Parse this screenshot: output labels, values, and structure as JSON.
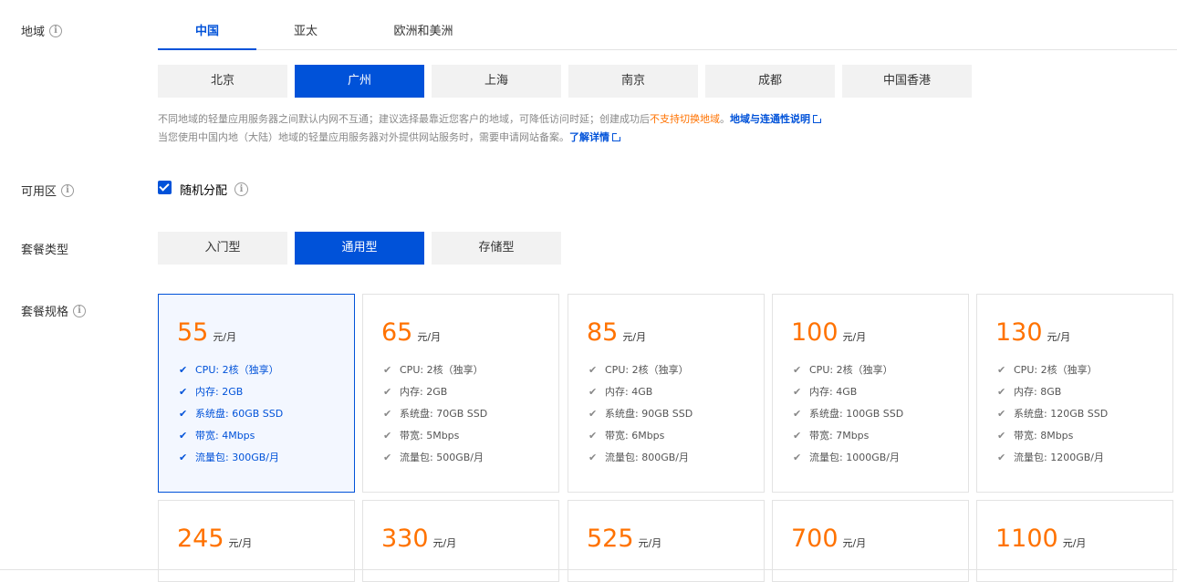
{
  "region": {
    "label": "地域",
    "tabs": [
      {
        "label": "中国",
        "active": true
      },
      {
        "label": "亚太",
        "active": false
      },
      {
        "label": "欧洲和美洲",
        "active": false
      }
    ],
    "cities": [
      {
        "label": "北京",
        "active": false
      },
      {
        "label": "广州",
        "active": true
      },
      {
        "label": "上海",
        "active": false
      },
      {
        "label": "南京",
        "active": false
      },
      {
        "label": "成都",
        "active": false
      },
      {
        "label": "中国香港",
        "active": false
      }
    ],
    "note1_prefix": "不同地域的轻量应用服务器之间默认内网不互通；建议选择最靠近您客户的地域，可降低访问时延；创建成功后",
    "note1_warn": "不支持切换地域",
    "note1_suffix": "。",
    "note1_link": "地域与连通性说明",
    "note2_text": "当您使用中国内地（大陆）地域的轻量应用服务器对外提供网站服务时，需要申请网站备案。",
    "note2_link": "了解详情"
  },
  "zone": {
    "label": "可用区",
    "checkbox_label": "随机分配",
    "checked": true
  },
  "plan_type": {
    "label": "套餐类型",
    "options": [
      {
        "label": "入门型",
        "active": false
      },
      {
        "label": "通用型",
        "active": true
      },
      {
        "label": "存储型",
        "active": false
      }
    ]
  },
  "plan_spec": {
    "label": "套餐规格",
    "unit": "元/月",
    "cards": [
      {
        "price": "55",
        "selected": true,
        "specs": [
          "CPU: 2核（独享）",
          "内存: 2GB",
          "系统盘: 60GB SSD",
          "带宽: 4Mbps",
          "流量包: 300GB/月"
        ]
      },
      {
        "price": "65",
        "selected": false,
        "specs": [
          "CPU: 2核（独享）",
          "内存: 2GB",
          "系统盘: 70GB SSD",
          "带宽: 5Mbps",
          "流量包: 500GB/月"
        ]
      },
      {
        "price": "85",
        "selected": false,
        "specs": [
          "CPU: 2核（独享）",
          "内存: 4GB",
          "系统盘: 90GB SSD",
          "带宽: 6Mbps",
          "流量包: 800GB/月"
        ]
      },
      {
        "price": "100",
        "selected": false,
        "specs": [
          "CPU: 2核（独享）",
          "内存: 4GB",
          "系统盘: 100GB SSD",
          "带宽: 7Mbps",
          "流量包: 1000GB/月"
        ]
      },
      {
        "price": "130",
        "selected": false,
        "specs": [
          "CPU: 2核（独享）",
          "内存: 8GB",
          "系统盘: 120GB SSD",
          "带宽: 8Mbps",
          "流量包: 1200GB/月"
        ]
      },
      {
        "price": "245",
        "selected": false,
        "specs": []
      },
      {
        "price": "330",
        "selected": false,
        "specs": []
      },
      {
        "price": "525",
        "selected": false,
        "specs": []
      },
      {
        "price": "700",
        "selected": false,
        "specs": []
      },
      {
        "price": "1100",
        "selected": false,
        "specs": []
      }
    ]
  },
  "colors": {
    "accent": "#0052d9",
    "price": "#ff7200",
    "warn": "#ff7200"
  }
}
